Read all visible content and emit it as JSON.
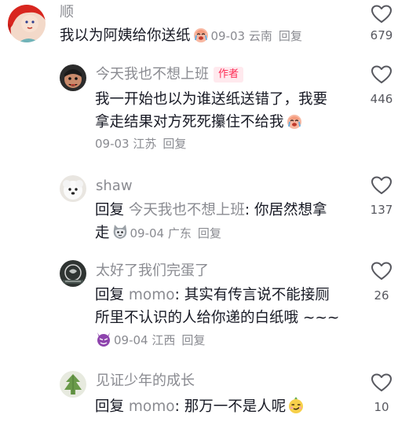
{
  "comments": [
    {
      "username": "顺",
      "text": "我以为阿姨给你送纸",
      "date": "09-03",
      "location": "云南",
      "reply_label": "回复",
      "likes": "679",
      "emoji": "crying-face-emoji"
    },
    {
      "username": "今天我也不想上班",
      "badge": "作者",
      "text_line1": "我一开始也以为谁送纸送错了，我要",
      "text_line2": "拿走结果对方死死攥住不给我",
      "date": "09-03",
      "location": "江苏",
      "reply_label": "回复",
      "likes": "446",
      "emoji": "crying-face-emoji"
    },
    {
      "username": "shaw",
      "reply_prefix": "回复",
      "reply_to": "今天我也不想上班",
      "text_line1_rest": ": 你居然想拿",
      "text_line2": "走",
      "date": "09-04",
      "location": "广东",
      "reply_label": "回复",
      "likes": "137",
      "emoji": "cat-face-emoji"
    },
    {
      "username": "太好了我们完蛋了",
      "reply_prefix": "回复",
      "reply_to": "momo",
      "text_line1_rest": ": 其实有传言说不能接厕",
      "text_line2": "所里不认识的人给你递的白纸哦 ~~~",
      "date": "09-04",
      "location": "江西",
      "reply_label": "回复",
      "likes": "26",
      "emoji": "devil-face-emoji"
    },
    {
      "username": "见证少年的成长",
      "reply_prefix": "回复",
      "reply_to": "momo",
      "text_line1_rest": ": 那万一不是人呢",
      "likes": "10",
      "emoji": "smirk-face-emoji"
    }
  ],
  "colors": {
    "text_primary": "#161823",
    "text_secondary": "#8a8b91",
    "badge_text": "#fe2c55",
    "badge_bg": "#ffe9ee"
  }
}
